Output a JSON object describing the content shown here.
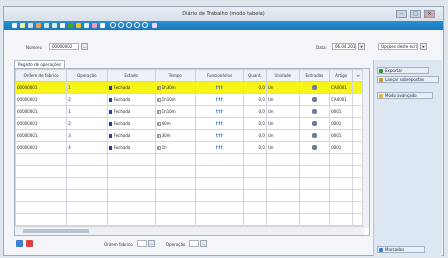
{
  "window": {
    "title": "Diário de Trabalho (modo tabela)",
    "controls": [
      "–",
      "□",
      "×"
    ]
  },
  "top": {
    "numero_label": "Número",
    "numero_value": "00000002",
    "data_label": "Data:",
    "data_value": "06.04.2013",
    "select_value": "Opções deste ecrã"
  },
  "tab_label": "Registo de operações",
  "table": {
    "headers": [
      "Ordem de fabrico",
      "Operação",
      "Estado",
      "Tempo",
      "Funcionários",
      "Quant.",
      "Unidade",
      "Entradas",
      "Artigo"
    ],
    "rows": [
      {
        "ordem": "00000001",
        "op": "1",
        "estado": "Fechada",
        "tempo": "1h30m",
        "func": "†††",
        "quant": "0,0",
        "uni": "Un",
        "art": "CA0001"
      },
      {
        "ordem": "00000001",
        "op": "2",
        "estado": "Fechada",
        "tempo": "1h10m",
        "func": "†††",
        "quant": "0,0",
        "uni": "Un",
        "art": "CA0001"
      },
      {
        "ordem": "00000001",
        "op": "1",
        "estado": "Fechada",
        "tempo": "1h10m",
        "func": "†††",
        "quant": "0,0",
        "uni": "Un",
        "art": "0001"
      },
      {
        "ordem": "00000001",
        "op": "2",
        "estado": "Fechada",
        "tempo": "40m",
        "func": "†††",
        "quant": "0,0",
        "uni": "Un",
        "art": "0001"
      },
      {
        "ordem": "00000001",
        "op": "3",
        "estado": "Fechada",
        "tempo": "30m",
        "func": "†††",
        "quant": "0,0",
        "uni": "Un",
        "art": "0001"
      },
      {
        "ordem": "00000001",
        "op": "4",
        "estado": "Fechada",
        "tempo": "1h",
        "func": "†††",
        "quant": "0,0",
        "uni": "Un",
        "art": "0001"
      }
    ]
  },
  "bottom": {
    "ordem_label": "Ordem fabrico",
    "ordem_value": "",
    "operacao_label": "Operação",
    "operacao_value": ""
  },
  "right": {
    "exportar": "Exportar",
    "lancar": "Lançar sobrepostas",
    "modo": "Modo avançado",
    "marcados": "Marcados"
  },
  "colors": {
    "toolbar": "#1a78bd",
    "selected_row": "#f7f41a",
    "panel": "#dde7f2"
  }
}
